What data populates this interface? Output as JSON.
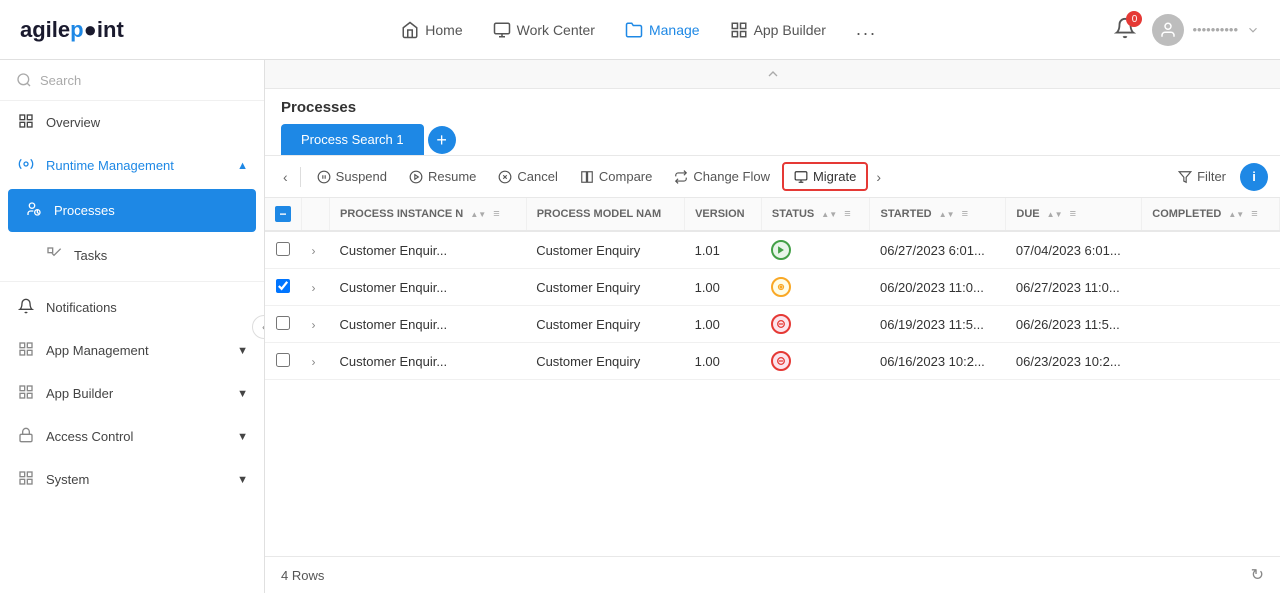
{
  "app": {
    "logo_text": "agilepoint"
  },
  "nav": {
    "items": [
      {
        "id": "home",
        "label": "Home",
        "icon": "🏠"
      },
      {
        "id": "work-center",
        "label": "Work Center",
        "icon": "🖥"
      },
      {
        "id": "manage",
        "label": "Manage",
        "icon": "📁",
        "active": true
      },
      {
        "id": "app-builder",
        "label": "App Builder",
        "icon": "⊞"
      },
      {
        "id": "more",
        "label": "...",
        "icon": ""
      }
    ],
    "notification_count": "0",
    "user_name": "••••••••••"
  },
  "sidebar": {
    "search_placeholder": "Search",
    "items": [
      {
        "id": "overview",
        "label": "Overview",
        "icon": "grid",
        "level": 0
      },
      {
        "id": "runtime-management",
        "label": "Runtime Management",
        "icon": "settings",
        "level": 0,
        "expanded": true,
        "active_parent": true
      },
      {
        "id": "processes",
        "label": "Processes",
        "icon": "people",
        "level": 1,
        "active": true
      },
      {
        "id": "tasks",
        "label": "Tasks",
        "icon": "checkbox",
        "level": 1
      },
      {
        "id": "notifications",
        "label": "Notifications",
        "icon": "bell",
        "level": 0
      },
      {
        "id": "app-management",
        "label": "App Management",
        "icon": "grid2",
        "level": 0,
        "has_chevron": true
      },
      {
        "id": "app-builder",
        "label": "App Builder",
        "icon": "grid3",
        "level": 0,
        "has_chevron": true
      },
      {
        "id": "access-control",
        "label": "Access Control",
        "icon": "lock",
        "level": 0,
        "has_chevron": true
      },
      {
        "id": "system",
        "label": "System",
        "icon": "grid4",
        "level": 0,
        "has_chevron": true
      }
    ]
  },
  "processes": {
    "title": "Processes",
    "tabs": [
      {
        "id": "search1",
        "label": "Process Search 1",
        "active": true
      }
    ],
    "add_tab_label": "+",
    "toolbar": {
      "back_label": "‹",
      "suspend_label": "Suspend",
      "resume_label": "Resume",
      "cancel_label": "Cancel",
      "compare_label": "Compare",
      "change_flow_label": "Change Flow",
      "migrate_label": "Migrate",
      "next_label": "›",
      "filter_label": "Filter",
      "info_label": "ℹ"
    },
    "table": {
      "columns": [
        {
          "id": "select",
          "label": ""
        },
        {
          "id": "expand",
          "label": ""
        },
        {
          "id": "process_instance",
          "label": "PROCESS INSTANCE N"
        },
        {
          "id": "process_model",
          "label": "PROCESS MODEL NAM"
        },
        {
          "id": "version",
          "label": "VERSION"
        },
        {
          "id": "status",
          "label": "STATUS"
        },
        {
          "id": "started",
          "label": "STARTED"
        },
        {
          "id": "due",
          "label": "DUE"
        },
        {
          "id": "completed",
          "label": "COMPLETED"
        }
      ],
      "rows": [
        {
          "id": "row1",
          "checked": false,
          "process_instance": "Customer Enquir...",
          "process_model": "Customer Enquiry",
          "version": "1.01",
          "status": "green",
          "status_icon": "▶",
          "started": "06/27/2023 6:01...",
          "due": "07/04/2023 6:01...",
          "completed": ""
        },
        {
          "id": "row2",
          "checked": true,
          "process_instance": "Customer Enquir...",
          "process_model": "Customer Enquiry",
          "version": "1.00",
          "status": "yellow",
          "status_icon": "⊙",
          "started": "06/20/2023 11:0...",
          "due": "06/27/2023 11:0...",
          "completed": ""
        },
        {
          "id": "row3",
          "checked": false,
          "process_instance": "Customer Enquir...",
          "process_model": "Customer Enquiry",
          "version": "1.00",
          "status": "red",
          "status_icon": "⊖",
          "started": "06/19/2023 11:5...",
          "due": "06/26/2023 11:5...",
          "completed": ""
        },
        {
          "id": "row4",
          "checked": false,
          "process_instance": "Customer Enquir...",
          "process_model": "Customer Enquiry",
          "version": "1.00",
          "status": "red",
          "status_icon": "⊖",
          "started": "06/16/2023 10:2...",
          "due": "06/23/2023 10:2...",
          "completed": ""
        }
      ],
      "row_count_label": "4 Rows"
    }
  }
}
